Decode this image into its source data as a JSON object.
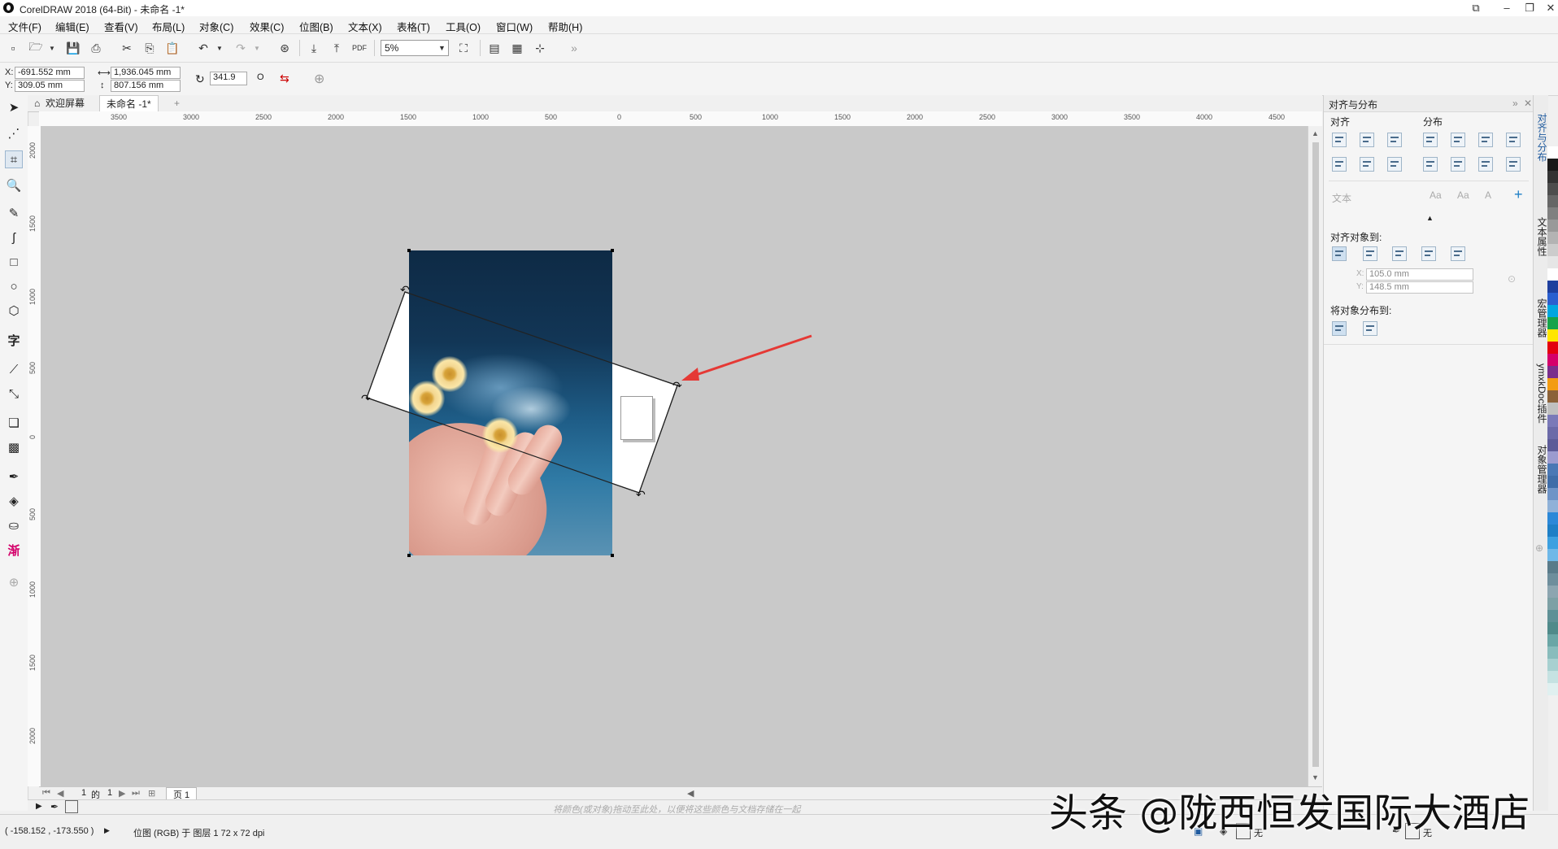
{
  "window": {
    "title": "CorelDRAW 2018 (64-Bit) - 未命名 -1*"
  },
  "menu": [
    "文件(F)",
    "编辑(E)",
    "查看(V)",
    "布局(L)",
    "对象(C)",
    "效果(C)",
    "位图(B)",
    "文本(X)",
    "表格(T)",
    "工具(O)",
    "窗口(W)",
    "帮助(H)"
  ],
  "toolbar": {
    "zoom": "5%",
    "pdf_label": "PDF"
  },
  "propbar": {
    "x": "-691.552 mm",
    "y": "309.05 mm",
    "x_label": "X:",
    "y_label": "Y:",
    "width": "1,936.045 mm",
    "height": "807.156 mm",
    "rotation": "341.9",
    "rotation_unit": "O"
  },
  "tabs": {
    "welcome": "欢迎屏幕",
    "doc": "未命名 -1*"
  },
  "ruler_h": [
    "3500",
    "3000",
    "2500",
    "2000",
    "1500",
    "1000",
    "500",
    "0",
    "500",
    "1000",
    "1500",
    "2000",
    "2500",
    "3000",
    "3500",
    "4000",
    "4500"
  ],
  "ruler_v": [
    "2000",
    "1500",
    "1000",
    "500",
    "0",
    "500",
    "1000",
    "1500",
    "2000"
  ],
  "pager": {
    "current": "1",
    "of": "的",
    "total": "1",
    "page_tab": "页 1"
  },
  "colorbar_hint": "将颜色(或对象)拖动至此处，以便将这些颜色与文档存储在一起",
  "status": {
    "coords": "( -158.152 , -173.550 )",
    "info": "位图 (RGB) 于 图层 1 72 x 72 dpi",
    "fill_none": "无",
    "outline_none": "无"
  },
  "docker": {
    "title": "对齐与分布",
    "align": "对齐",
    "distribute": "分布",
    "text": "文本",
    "align_to": "对齐对象到:",
    "x_field": "105.0 mm",
    "y_field": "148.5 mm",
    "x_label": "X:",
    "y_label": "Y:",
    "distribute_to": "将对象分布到:"
  },
  "dock_tabs": [
    "对齐与分布",
    "文本属性",
    "宏管理器",
    "ymxkDoc插件",
    "对象管理器"
  ],
  "tools": {
    "text": "字",
    "fill": "渐"
  },
  "watermark": "头条 @陇西恒发国际大酒店",
  "palette": [
    "#ffffff",
    "#1a1a1a",
    "#333333",
    "#4d4d4d",
    "#666666",
    "#808080",
    "#999999",
    "#b3b3b3",
    "#cccccc",
    "#e6e6e6",
    "#ffffff",
    "#1e3f9e",
    "#2a5fcf",
    "#00a6e0",
    "#16a34a",
    "#ffe600",
    "#e3000f",
    "#d4006a",
    "#7a2e8c",
    "#f39c12",
    "#8c6239",
    "#c0c0c0",
    "#7a79b8",
    "#6b6aa8",
    "#5d5c98",
    "#9b9bcf",
    "#4a78b5",
    "#3f6da8",
    "#6f94c7",
    "#8fb1d8",
    "#2b88d8",
    "#1e7fc6",
    "#3da0e0",
    "#6fb8e8",
    "#5a7b8a",
    "#6e8e9c",
    "#8ca5b0",
    "#7da0a5",
    "#5f9096",
    "#4f8a8a",
    "#6aa6a6",
    "#88bcbc",
    "#a7d0d0",
    "#c5e2e2",
    "#e0f0f0"
  ]
}
